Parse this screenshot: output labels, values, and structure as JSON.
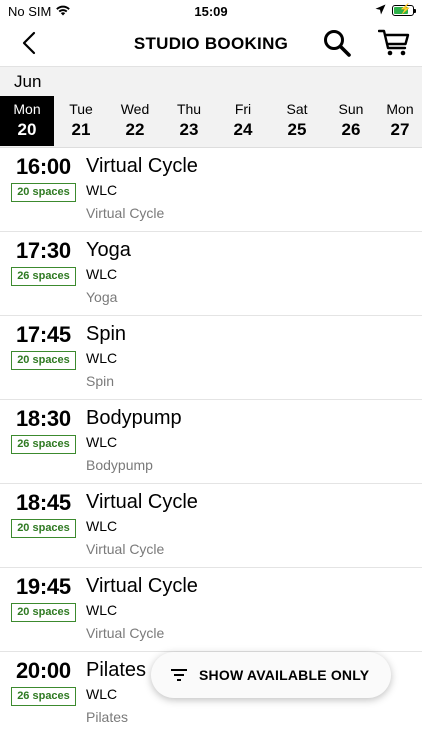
{
  "status_bar": {
    "carrier": "No SIM",
    "time": "15:09",
    "battery_level": 0.8,
    "battery_color": "#2fb14a"
  },
  "header": {
    "title": "STUDIO BOOKING",
    "back_icon": "chevron-left-icon",
    "search_icon": "search-icon",
    "cart_icon": "cart-icon"
  },
  "calendar": {
    "month": "Jun",
    "days": [
      {
        "dow": "Mon",
        "num": "20",
        "selected": true
      },
      {
        "dow": "Tue",
        "num": "21",
        "selected": false
      },
      {
        "dow": "Wed",
        "num": "22",
        "selected": false
      },
      {
        "dow": "Thu",
        "num": "23",
        "selected": false
      },
      {
        "dow": "Fri",
        "num": "24",
        "selected": false
      },
      {
        "dow": "Sat",
        "num": "25",
        "selected": false
      },
      {
        "dow": "Sun",
        "num": "26",
        "selected": false
      },
      {
        "dow": "Mon",
        "num": "27",
        "selected": false
      }
    ]
  },
  "classes": [
    {
      "time": "16:00",
      "spaces": "20 spaces",
      "name": "Virtual Cycle",
      "location": "WLC",
      "subtitle": "Virtual Cycle"
    },
    {
      "time": "17:30",
      "spaces": "26 spaces",
      "name": "Yoga",
      "location": "WLC",
      "subtitle": "Yoga"
    },
    {
      "time": "17:45",
      "spaces": "20 spaces",
      "name": "Spin",
      "location": "WLC",
      "subtitle": "Spin"
    },
    {
      "time": "18:30",
      "spaces": "26 spaces",
      "name": "Bodypump",
      "location": "WLC",
      "subtitle": "Bodypump"
    },
    {
      "time": "18:45",
      "spaces": "20 spaces",
      "name": "Virtual Cycle",
      "location": "WLC",
      "subtitle": "Virtual Cycle"
    },
    {
      "time": "19:45",
      "spaces": "20 spaces",
      "name": "Virtual Cycle",
      "location": "WLC",
      "subtitle": "Virtual Cycle"
    },
    {
      "time": "20:00",
      "spaces": "26 spaces",
      "name": "Pilates",
      "location": "WLC",
      "subtitle": "Pilates"
    }
  ],
  "filter_button": {
    "label": "SHOW AVAILABLE ONLY",
    "icon": "filter-icon"
  },
  "colors": {
    "spaces_badge": "#2f7a22",
    "selected_day_bg": "#000000",
    "date_strip_bg": "#f2f2f2"
  }
}
